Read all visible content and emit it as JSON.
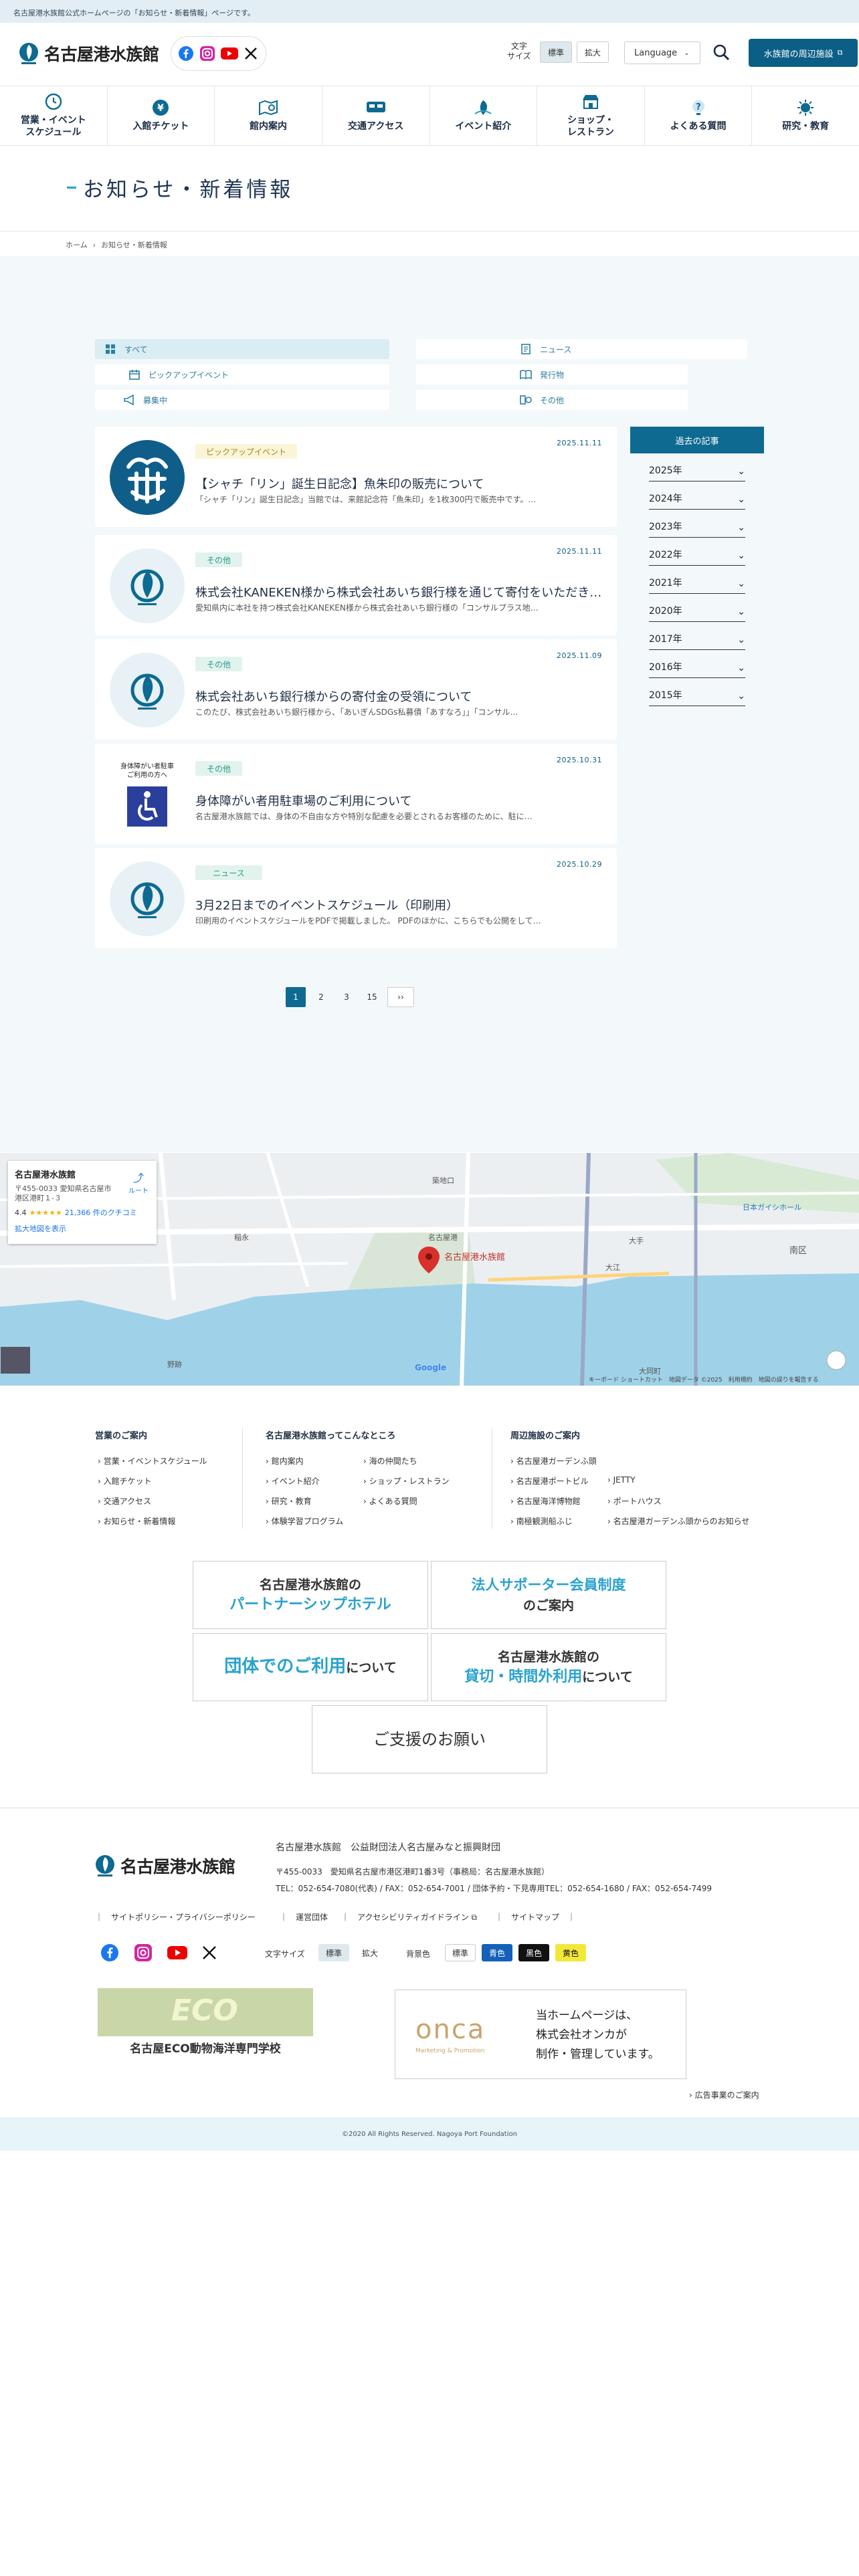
{
  "topbar": {
    "notice": "名古屋港水族館公式ホームページの「お知らせ・新着情報」ページです。"
  },
  "header": {
    "logo_text": "名古屋港水族館",
    "font_size_label_1": "文字",
    "font_size_label_2": "サイズ",
    "font_standard": "標準",
    "font_large": "拡大",
    "language": "Language",
    "nearby": "水族館の周辺施設"
  },
  "gnav": [
    {
      "l1": "営業・イベント",
      "l2": "スケジュール",
      "icon": "clock-icon"
    },
    {
      "l1": "入館チケット",
      "l2": "",
      "icon": "ticket-icon"
    },
    {
      "l1": "館内案内",
      "l2": "",
      "icon": "map-guide-icon"
    },
    {
      "l1": "交通アクセス",
      "l2": "",
      "icon": "bus-icon"
    },
    {
      "l1": "イベント紹介",
      "l2": "",
      "icon": "event-icon"
    },
    {
      "l1": "ショップ・",
      "l2": "レストラン",
      "icon": "shop-icon"
    },
    {
      "l1": "よくある質問",
      "l2": "",
      "icon": "question-icon"
    },
    {
      "l1": "研究・教育",
      "l2": "",
      "icon": "research-icon"
    }
  ],
  "page": {
    "title": "お知らせ・新着情報"
  },
  "breadcrumb": {
    "home": "ホーム",
    "current": "お知らせ・新着情報"
  },
  "tabs": [
    {
      "label": "すべて",
      "icon": "grid-icon"
    },
    {
      "label": "ニュース",
      "icon": "document-icon"
    },
    {
      "label": "ピックアップイベント",
      "icon": "calendar-icon"
    },
    {
      "label": "発行物",
      "icon": "book-icon"
    },
    {
      "label": "募集中",
      "icon": "megaphone-icon"
    },
    {
      "label": "その他",
      "icon": "misc-icon"
    }
  ],
  "news": [
    {
      "category": "ピックアップイベント",
      "date": "2025.11.11",
      "title": "【シャチ「リン」誕生日記念】魚朱印の販売について",
      "desc": "「シャチ「リン」誕生日記念」当館では、来館記念符「魚朱印」を1枚300円で販売中です。…",
      "thumb": "stamp"
    },
    {
      "category": "その他",
      "date": "2025.11.11",
      "title": "株式会社KANEKEN様から株式会社あいち銀行様を通じて寄付をいただきました",
      "desc": "愛知県内に本社を持つ株式会社KANEKEN様から株式会社あいち銀行様の「コンサルプラス地…",
      "thumb": "logo"
    },
    {
      "category": "その他",
      "date": "2025.11.09",
      "title": "株式会社あいち銀行様からの寄付金の受領について",
      "desc": "このたび、株式会社あいち銀行様から、「あいぎんSDGs私募債「あすなろ」」「コンサル…",
      "thumb": "logo"
    },
    {
      "category": "その他",
      "date": "2025.10.31",
      "title": "身体障がい者用駐車場のご利用について",
      "desc": "名古屋港水族館では、身体の不自由な方や特別な配慮を必要とされるお客様のために、駐に…",
      "thumb": "parking",
      "thumb_text_1": "身体障がい者駐車",
      "thumb_text_2": "ご利用の方へ"
    },
    {
      "category": "ニュース",
      "date": "2025.10.29",
      "title": "3月22日までのイベントスケジュール（印刷用）",
      "desc": "印刷用のイベントスケジュールをPDFで掲載しました。 PDFのほかに、こちらでも公開をして…",
      "thumb": "logo"
    }
  ],
  "archive": {
    "title": "過去の記事",
    "years": [
      "2025年",
      "2024年",
      "2023年",
      "2022年",
      "2021年",
      "2020年",
      "2017年",
      "2016年",
      "2015年"
    ]
  },
  "pager": {
    "pages": [
      "1",
      "2",
      "3",
      "15"
    ],
    "next": "››"
  },
  "map": {
    "place": "名古屋港水族館",
    "address": "〒455-0033 愛知県名古屋市港区港町１-３",
    "route": "ルート",
    "rating": "4.4",
    "stars": "★★★★★",
    "reviews": "21,366 件のクチコミ",
    "enlarge": "拡大地図を表示",
    "pin_label": "名古屋港水族館",
    "footer_text": "キーボード ショートカット　地図データ ©2025　利用規約　地図の誤りを報告する",
    "area_labels": [
      "築地口",
      "南区",
      "大江",
      "大手",
      "名古屋港",
      "野跡",
      "稲永",
      "大同町",
      "日本ガイシホール"
    ]
  },
  "footer_links": {
    "col1": {
      "title": "営業のご案内",
      "items": [
        "営業・イベントスケジュール",
        "入館チケット",
        "交通アクセス",
        "お知らせ・新着情報"
      ]
    },
    "col2": {
      "title": "名古屋港水族館ってこんなところ",
      "items_a": [
        "館内案内",
        "イベント紹介",
        "研究・教育",
        "体験学習プログラム"
      ],
      "items_b": [
        "海の仲間たち",
        "ショップ・レストラン",
        "よくある質問"
      ]
    },
    "col3": {
      "title": "周辺施設のご案内",
      "items_a": [
        "名古屋港ガーデンふ頭",
        "名古屋港ポートビル",
        "名古屋海洋博物館",
        "南極観測船ふじ"
      ],
      "items_b": [
        "JETTY",
        "ポートハウス",
        "名古屋港ガーデンふ頭からのお知らせ"
      ]
    }
  },
  "banners": {
    "b1_line1": "名古屋港水族館の",
    "b1_line2": "パートナーシップホテル",
    "b2_line1": "法人サポーター会員制度",
    "b2_line2": "のご案内",
    "b3_line1": "団体でのご利用",
    "b3_line2": "について",
    "b4_line1": "名古屋港水族館の",
    "b4_line2": "貸切・時間外利用",
    "b4_line3": "について",
    "b5": "ご支援のお願い"
  },
  "footer": {
    "logo_text": "名古屋港水族館",
    "org": "名古屋港水族館　公益財団法人名古屋みなと振興財団",
    "addr": "〒455-0033　愛知県名古屋市港区港町1番3号（事務局：名古屋港水族館）",
    "tel": "TEL：052-654-7080(代表) / FAX：052-654-7001 / 団体予約・下見専用TEL：052-654-1680 / FAX：052-654-7499",
    "links": [
      "サイトポリシー・プライバシーポリシー",
      "運営団体",
      "アクセシビリティガイドライン",
      "サイトマップ"
    ],
    "fs_label": "文字サイズ",
    "fs_std": "標準",
    "fs_large": "拡大",
    "bg_label": "背景色",
    "bg_std": "標準",
    "bg_blue": "青色",
    "bg_black": "黒色",
    "bg_yellow": "黄色",
    "eco_name": "名古屋ECO動物海洋専門学校",
    "eco_label": "ECO",
    "onca_logo": "onca",
    "onca_sub": "Marketing & Promotion",
    "onca_text_1": "当ホームページは、",
    "onca_text_2": "株式会社オンカが",
    "onca_text_3": "制作・管理しています。",
    "ad_link": "広告事業のご案内",
    "copyright": "©2020 All Rights Reserved. Nagoya Port Foundation"
  },
  "colors": {
    "primary": "#0e6a91",
    "accent": "#2ba0c8",
    "category_bg": "#e2f3ee"
  }
}
